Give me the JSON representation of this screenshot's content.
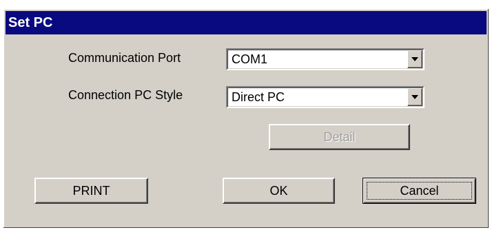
{
  "window": {
    "title": "Set PC"
  },
  "form": {
    "port_label": "Communication Port",
    "port_value": "COM1",
    "style_label": "Connection PC Style",
    "style_value": "Direct PC"
  },
  "buttons": {
    "detail": "Detail",
    "print": "PRINT",
    "ok": "OK",
    "cancel": "Cancel"
  },
  "colors": {
    "titlebar": "#0a0a80",
    "face": "#d4d0c8"
  }
}
